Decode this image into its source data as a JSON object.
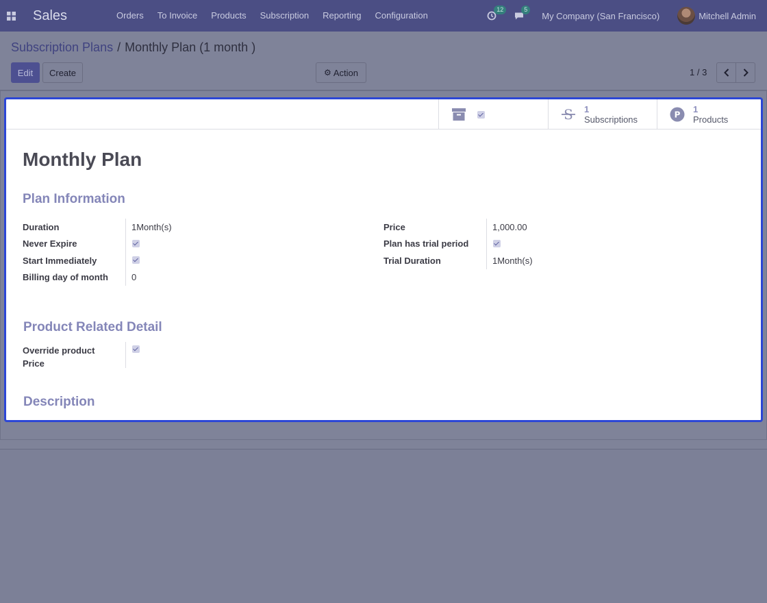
{
  "navbar": {
    "app_name": "Sales",
    "menu": [
      "Orders",
      "To Invoice",
      "Products",
      "Subscription",
      "Reporting",
      "Configuration"
    ],
    "activity_count": "12",
    "message_count": "5",
    "company": "My Company (San Francisco)",
    "user": "Mitchell Admin"
  },
  "breadcrumb": {
    "parent": "Subscription Plans",
    "separator": "/",
    "current": "Monthly Plan (1 month )"
  },
  "toolbar": {
    "edit_label": "Edit",
    "create_label": "Create",
    "action_label": "Action",
    "pager": "1 / 3"
  },
  "smart_buttons": {
    "archive": {
      "icon": "archive-icon",
      "checked": true
    },
    "subscriptions": {
      "value": "1",
      "label": "Subscriptions",
      "icon": "subscription-icon"
    },
    "products": {
      "value": "1",
      "label": "Products",
      "icon": "product-icon"
    }
  },
  "form": {
    "name": "Monthly Plan",
    "sections": {
      "plan_info": "Plan Information",
      "product_detail": "Product Related Detail",
      "description": "Description"
    },
    "fields": {
      "duration": {
        "label": "Duration",
        "value": "1Month(s)"
      },
      "never_expire": {
        "label": "Never Expire",
        "checked": true
      },
      "start_immediately": {
        "label": "Start Immediately",
        "checked": true
      },
      "billing_day": {
        "label": "Billing day of month",
        "value": "0"
      },
      "price": {
        "label": "Price",
        "value": "1,000.00"
      },
      "trial_period": {
        "label": "Plan has trial period",
        "checked": true
      },
      "trial_duration": {
        "label": "Trial Duration",
        "value": "1Month(s)"
      },
      "override_price": {
        "label_line1": "Override product",
        "label_line2": "Price",
        "checked": true
      }
    }
  },
  "colors": {
    "navbar": "#4b4e84",
    "primary_button": "#4d5091",
    "section_title": "#8486b8",
    "highlight_border": "#2c46d6"
  }
}
